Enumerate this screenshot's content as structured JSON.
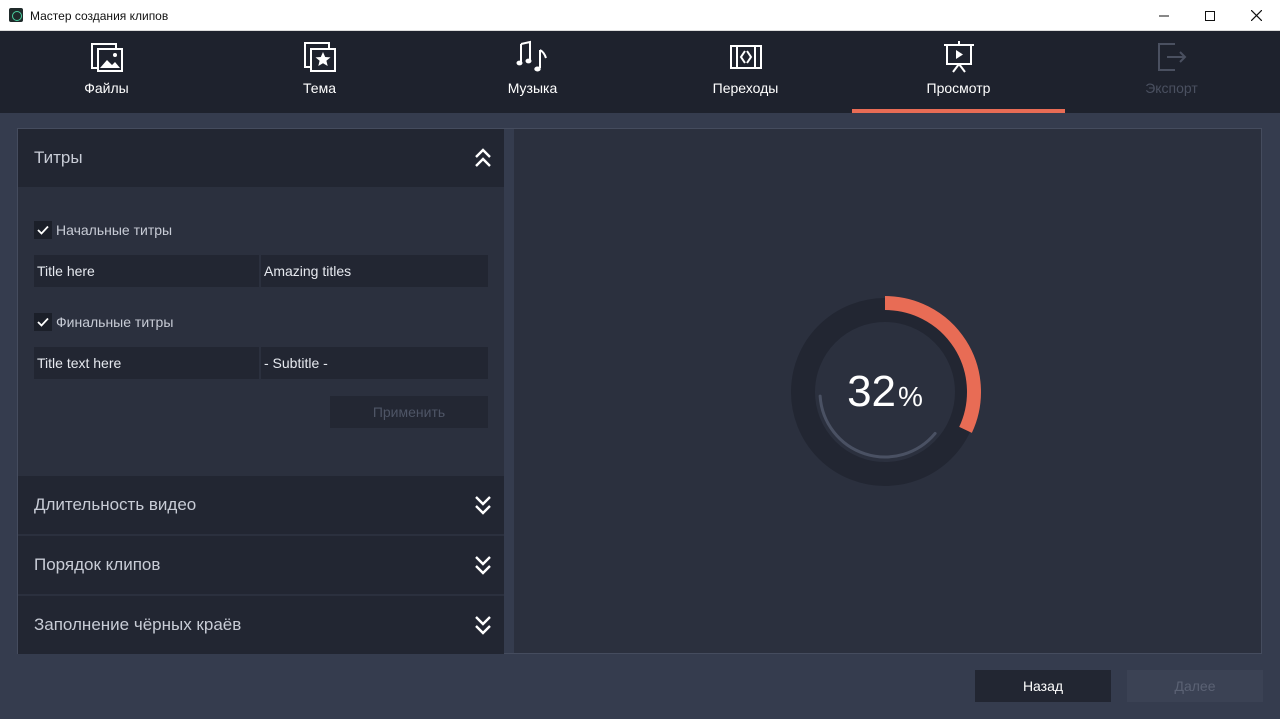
{
  "window": {
    "title": "Мастер создания клипов",
    "minimize": "—",
    "maximize": "☐",
    "close": "✕"
  },
  "tabs": [
    {
      "label": "Файлы",
      "icon": "files-icon",
      "active": false,
      "disabled": false
    },
    {
      "label": "Тема",
      "icon": "theme-star-icon",
      "active": false,
      "disabled": false
    },
    {
      "label": "Музыка",
      "icon": "music-note-icon",
      "active": false,
      "disabled": false
    },
    {
      "label": "Переходы",
      "icon": "transitions-icon",
      "active": false,
      "disabled": false
    },
    {
      "label": "Просмотр",
      "icon": "preview-presentation-icon",
      "active": true,
      "disabled": false
    },
    {
      "label": "Экспорт",
      "icon": "export-icon",
      "active": false,
      "disabled": true
    }
  ],
  "titles_section": {
    "header": "Титры",
    "opening": {
      "label": "Начальные титры",
      "checked": true,
      "field1": "Title here",
      "field2": "Amazing titles"
    },
    "closing": {
      "label": "Финальные титры",
      "checked": true,
      "field1": "Title text here",
      "field2": "- Subtitle -"
    },
    "apply_label": "Применить"
  },
  "sections": [
    {
      "header": "Длительность видео"
    },
    {
      "header": "Порядок клипов"
    },
    {
      "header": "Заполнение чёрных краёв"
    }
  ],
  "progress": {
    "value": "32",
    "unit": "%",
    "fraction": 0.32
  },
  "buttons": {
    "back": "Назад",
    "next": "Далее"
  },
  "colors": {
    "accent": "#e86c55",
    "background": "#2b303e",
    "tabbar": "#1e222d"
  }
}
